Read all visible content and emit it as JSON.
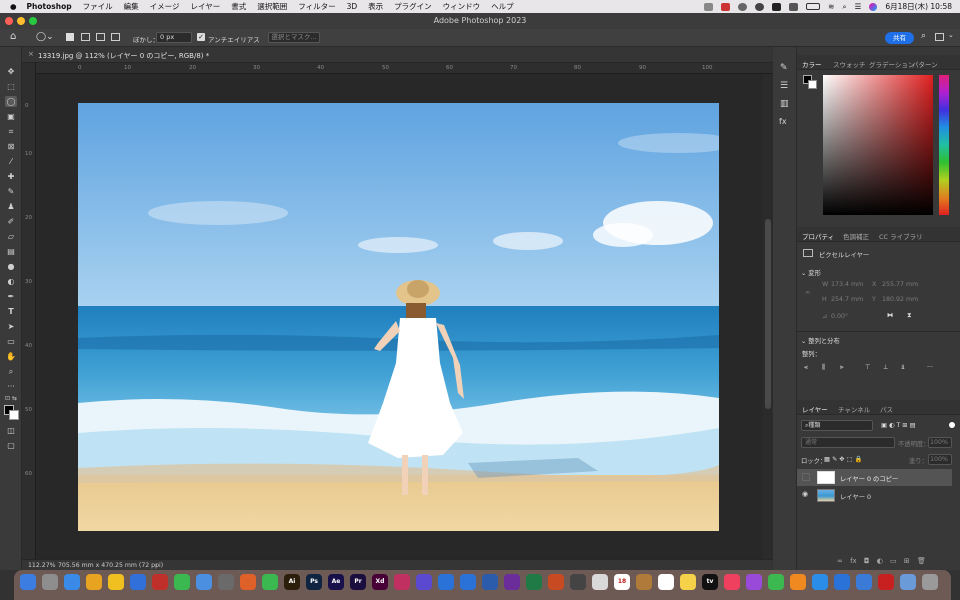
{
  "menubar": {
    "app": "Photoshop",
    "items": [
      "ファイル",
      "編集",
      "イメージ",
      "レイヤー",
      "書式",
      "選択範囲",
      "フィルター",
      "3D",
      "表示",
      "プラグイン",
      "ウィンドウ",
      "ヘルプ"
    ],
    "datetime": "6月18日(木) 10:58"
  },
  "window": {
    "title": "Adobe Photoshop 2023"
  },
  "options": {
    "feather_label": "ぼかし：",
    "feather_value": "0 px",
    "antialias_label": "アンチエイリアス",
    "select_mask_label": "選択とマスク...",
    "share_label": "共有"
  },
  "document": {
    "tab_title": "13319.jpg @ 112% (レイヤー 0 のコピー, RGB/8) *",
    "zoom": "112.27%",
    "doc_info": "705.56 mm x 470.25 mm (72 ppi)"
  },
  "ruler_h": [
    "0",
    "10",
    "20",
    "30",
    "40",
    "50",
    "60",
    "70",
    "80",
    "90",
    "100"
  ],
  "ruler_v": [
    "0",
    "10",
    "20",
    "30",
    "40",
    "50",
    "60"
  ],
  "color_panel": {
    "tabs": [
      "カラー",
      "スウォッチ",
      "グラデーション",
      "パターン"
    ]
  },
  "properties_panel": {
    "tabs": [
      "プロパティ",
      "色調補正",
      "CC ライブラリ"
    ],
    "layer_type": "ピクセルレイヤー",
    "transform_header": "変形",
    "w_label": "W",
    "w_value": "173.4 mm",
    "h_label": "H",
    "h_value": "254.7 mm",
    "x_label": "X",
    "x_value": "255.77 mm",
    "y_label": "Y",
    "y_value": "180.92 mm",
    "angle_value": "0.00°",
    "align_header": "整列と分布",
    "align_label": "整列："
  },
  "layers_panel": {
    "tabs": [
      "レイヤー",
      "チャンネル",
      "パス"
    ],
    "filter_kind": "種類",
    "blend_mode": "通常",
    "opacity_label": "不透明度：",
    "opacity_value": "100%",
    "lock_label": "ロック：",
    "fill_label": "塗り：",
    "fill_value": "100%",
    "layers": [
      {
        "name": "レイヤー 0 のコピー",
        "visible": false,
        "selected": true
      },
      {
        "name": "レイヤー 0",
        "visible": true,
        "selected": false
      }
    ]
  },
  "dock": {
    "apps": [
      {
        "label": "",
        "color": "#3b7de0"
      },
      {
        "label": "",
        "color": "#8e8e8e"
      },
      {
        "label": "",
        "color": "#3a8be8"
      },
      {
        "label": "",
        "color": "#e8a320"
      },
      {
        "label": "",
        "color": "#f0c020"
      },
      {
        "label": "",
        "color": "#3070d8"
      },
      {
        "label": "",
        "color": "#c0302a"
      },
      {
        "label": "",
        "color": "#3cb850"
      },
      {
        "label": "",
        "color": "#4a8fe0"
      },
      {
        "label": "",
        "color": "#6a6a6a"
      },
      {
        "label": "",
        "color": "#e0602a"
      },
      {
        "label": "",
        "color": "#3cb850"
      },
      {
        "label": "Ai",
        "color": "#2b1f0b"
      },
      {
        "label": "Ps",
        "color": "#0e2440"
      },
      {
        "label": "Ae",
        "color": "#17104a"
      },
      {
        "label": "Pr",
        "color": "#1a0e3e"
      },
      {
        "label": "Xd",
        "color": "#470137"
      },
      {
        "label": "",
        "color": "#c03060"
      },
      {
        "label": "",
        "color": "#5b4ad0"
      },
      {
        "label": "",
        "color": "#2a72d8"
      },
      {
        "label": "",
        "color": "#2a72d8"
      },
      {
        "label": "",
        "color": "#2b5cab"
      },
      {
        "label": "",
        "color": "#6a2d9a"
      },
      {
        "label": "",
        "color": "#207a45"
      },
      {
        "label": "",
        "color": "#c84a22"
      },
      {
        "label": "",
        "color": "#444"
      },
      {
        "label": "",
        "color": "#d9d9d9"
      },
      {
        "label": "18",
        "color": "#ffffff"
      },
      {
        "label": "",
        "color": "#b07a3a"
      },
      {
        "label": "",
        "color": "#ffffff"
      },
      {
        "label": "",
        "color": "#f6d24a"
      },
      {
        "label": "tv",
        "color": "#111"
      },
      {
        "label": "",
        "color": "#f04060"
      },
      {
        "label": "",
        "color": "#9a4ad8"
      },
      {
        "label": "",
        "color": "#3cb850"
      },
      {
        "label": "",
        "color": "#f08a20"
      },
      {
        "label": "",
        "color": "#2a8de8"
      },
      {
        "label": "",
        "color": "#2a72d8"
      },
      {
        "label": "",
        "color": "#3a7bd8"
      },
      {
        "label": "",
        "color": "#c82020"
      },
      {
        "label": "",
        "color": "#6a9ad8"
      },
      {
        "label": "",
        "color": "#9a9a9a"
      }
    ]
  }
}
